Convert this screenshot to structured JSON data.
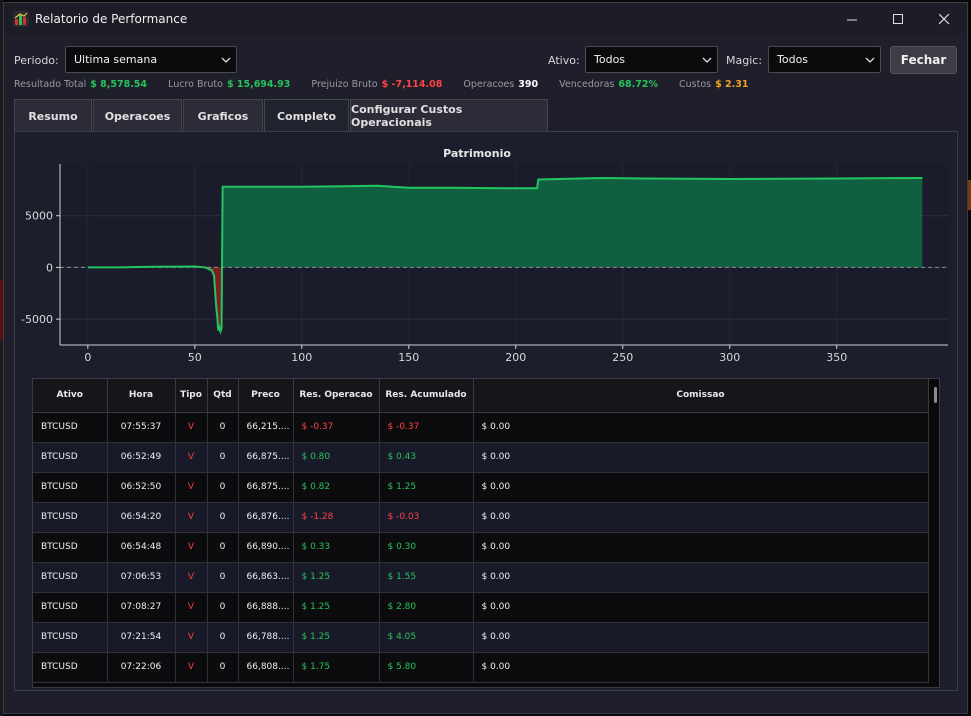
{
  "window": {
    "title": "Relatorio de Performance"
  },
  "filters": {
    "periodo_label": "Periodo:",
    "periodo_value": "Ultima semana",
    "ativo_label": "Ativo:",
    "ativo_value": "Todos",
    "magic_label": "Magic:",
    "magic_value": "Todos",
    "fechar_label": "Fechar"
  },
  "stats": {
    "resultado_label": "Resultado Total",
    "resultado_value": "$ 8,578.54",
    "lucro_label": "Lucro Bruto",
    "lucro_value": "$ 15,694.93",
    "prejuizo_label": "Prejuizo Bruto",
    "prejuizo_value": "$ -7,114.08",
    "operacoes_label": "Operacoes",
    "operacoes_value": "390",
    "vencedoras_label": "Vencedoras",
    "vencedoras_value": "68.72%",
    "custos_label": "Custos",
    "custos_value": "$ 2.31"
  },
  "tabs": [
    {
      "label": "Resumo"
    },
    {
      "label": "Operacoes"
    },
    {
      "label": "Graficos"
    },
    {
      "label": "Completo"
    },
    {
      "label": "Configurar Custos Operacionais"
    }
  ],
  "chart_data": {
    "type": "area",
    "title": "Patrimonio",
    "xlim": [
      -13,
      402
    ],
    "ylim": [
      -7500,
      10000
    ],
    "x_ticks": [
      0,
      50,
      100,
      150,
      200,
      250,
      300,
      350
    ],
    "y_ticks": [
      -5000,
      0,
      5000
    ],
    "points": [
      [
        0,
        0
      ],
      [
        15,
        0
      ],
      [
        20,
        30
      ],
      [
        30,
        60
      ],
      [
        40,
        80
      ],
      [
        50,
        90
      ],
      [
        55,
        0
      ],
      [
        58,
        -300
      ],
      [
        59,
        -800
      ],
      [
        59.5,
        -2300
      ],
      [
        60,
        -3800
      ],
      [
        60.5,
        -4800
      ],
      [
        61,
        -6100
      ],
      [
        61.5,
        -5800
      ],
      [
        62,
        -6200
      ],
      [
        62.5,
        -5900
      ],
      [
        63,
        7800
      ],
      [
        80,
        7800
      ],
      [
        100,
        7800
      ],
      [
        120,
        7850
      ],
      [
        135,
        7900
      ],
      [
        150,
        7700
      ],
      [
        170,
        7700
      ],
      [
        195,
        7650
      ],
      [
        210,
        7650
      ],
      [
        210.5,
        8500
      ],
      [
        240,
        8650
      ],
      [
        260,
        8600
      ],
      [
        300,
        8550
      ],
      [
        350,
        8600
      ],
      [
        390,
        8650
      ]
    ],
    "line_color": "#22c55e",
    "positive_fill": "#0f6b45",
    "negative_fill": "#8a1f24"
  },
  "table": {
    "columns": [
      "Ativo",
      "Hora",
      "Tipo",
      "Qtd",
      "Preco",
      "Res. Operacao",
      "Res. Acumulado",
      "Comissao"
    ],
    "rows": [
      {
        "ativo": "BTCUSD",
        "hora": "07:55:37",
        "tipo": "V",
        "qtd": "0",
        "preco": "66,215....",
        "res_op": "$ -0.37",
        "res_op_sign": "neg",
        "res_acc": "$ -0.37",
        "res_acc_sign": "neg",
        "comissao": "$ 0.00"
      },
      {
        "ativo": "BTCUSD",
        "hora": "06:52:49",
        "tipo": "V",
        "qtd": "0",
        "preco": "66,875....",
        "res_op": "$ 0.80",
        "res_op_sign": "pos",
        "res_acc": "$ 0.43",
        "res_acc_sign": "pos",
        "comissao": "$ 0.00"
      },
      {
        "ativo": "BTCUSD",
        "hora": "06:52:50",
        "tipo": "V",
        "qtd": "0",
        "preco": "66,875....",
        "res_op": "$ 0.82",
        "res_op_sign": "pos",
        "res_acc": "$ 1.25",
        "res_acc_sign": "pos",
        "comissao": "$ 0.00"
      },
      {
        "ativo": "BTCUSD",
        "hora": "06:54:20",
        "tipo": "V",
        "qtd": "0",
        "preco": "66,876....",
        "res_op": "$ -1.28",
        "res_op_sign": "neg",
        "res_acc": "$ -0.03",
        "res_acc_sign": "neg",
        "comissao": "$ 0.00"
      },
      {
        "ativo": "BTCUSD",
        "hora": "06:54:48",
        "tipo": "V",
        "qtd": "0",
        "preco": "66,890....",
        "res_op": "$ 0.33",
        "res_op_sign": "pos",
        "res_acc": "$ 0.30",
        "res_acc_sign": "pos",
        "comissao": "$ 0.00"
      },
      {
        "ativo": "BTCUSD",
        "hora": "07:06:53",
        "tipo": "V",
        "qtd": "0",
        "preco": "66,863....",
        "res_op": "$ 1.25",
        "res_op_sign": "pos",
        "res_acc": "$ 1.55",
        "res_acc_sign": "pos",
        "comissao": "$ 0.00"
      },
      {
        "ativo": "BTCUSD",
        "hora": "07:08:27",
        "tipo": "V",
        "qtd": "0",
        "preco": "66,888....",
        "res_op": "$ 1.25",
        "res_op_sign": "pos",
        "res_acc": "$ 2.80",
        "res_acc_sign": "pos",
        "comissao": "$ 0.00"
      },
      {
        "ativo": "BTCUSD",
        "hora": "07:21:54",
        "tipo": "V",
        "qtd": "0",
        "preco": "66,788....",
        "res_op": "$ 1.25",
        "res_op_sign": "pos",
        "res_acc": "$ 4.05",
        "res_acc_sign": "pos",
        "comissao": "$ 0.00"
      },
      {
        "ativo": "BTCUSD",
        "hora": "07:22:06",
        "tipo": "V",
        "qtd": "0",
        "preco": "66,808....",
        "res_op": "$ 1.75",
        "res_op_sign": "pos",
        "res_acc": "$ 5.80",
        "res_acc_sign": "pos",
        "comissao": "$ 0.00"
      }
    ]
  }
}
